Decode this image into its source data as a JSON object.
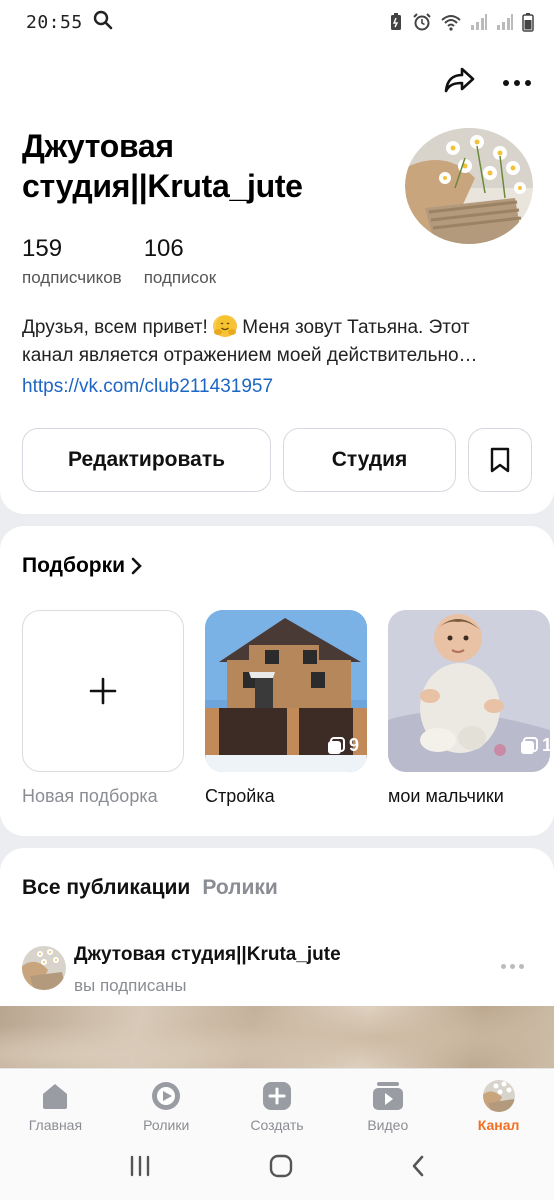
{
  "status_bar": {
    "time": "20:55"
  },
  "profile": {
    "name": "Джутовая студия||Kruta_jute",
    "followers_count": "159",
    "followers_label": "подписчиков",
    "following_count": "106",
    "following_label": "подписок",
    "description_line1_a": "Друзья, всем привет!",
    "description_line1_b": "Меня зовут Татьяна. Этот",
    "description_line2": "канал является отражением моей действительно…",
    "link": "https://vk.com/club211431957",
    "edit_button": "Редактировать",
    "studio_button": "Студия"
  },
  "collections": {
    "title": "Подборки",
    "items": [
      {
        "label": "Новая подборка"
      },
      {
        "label": "Стройка",
        "count": "9"
      },
      {
        "label": "мои мальчики",
        "count": "1"
      }
    ]
  },
  "publications": {
    "tab_all": "Все публикации",
    "tab_reels": "Ролики",
    "post": {
      "author": "Джутовая студия||Kruta_jute",
      "subtitle": "вы подписаны"
    }
  },
  "bottom_nav": {
    "items": [
      {
        "label": "Главная",
        "icon": "home-icon"
      },
      {
        "label": "Ролики",
        "icon": "reels-icon"
      },
      {
        "label": "Создать",
        "icon": "create-icon"
      },
      {
        "label": "Видео",
        "icon": "video-icon"
      },
      {
        "label": "Канал",
        "icon": "channel-avatar",
        "active": true
      }
    ]
  },
  "colors": {
    "accent": "#f26f21",
    "link": "#1d66c3",
    "background": "#ebedf0"
  }
}
